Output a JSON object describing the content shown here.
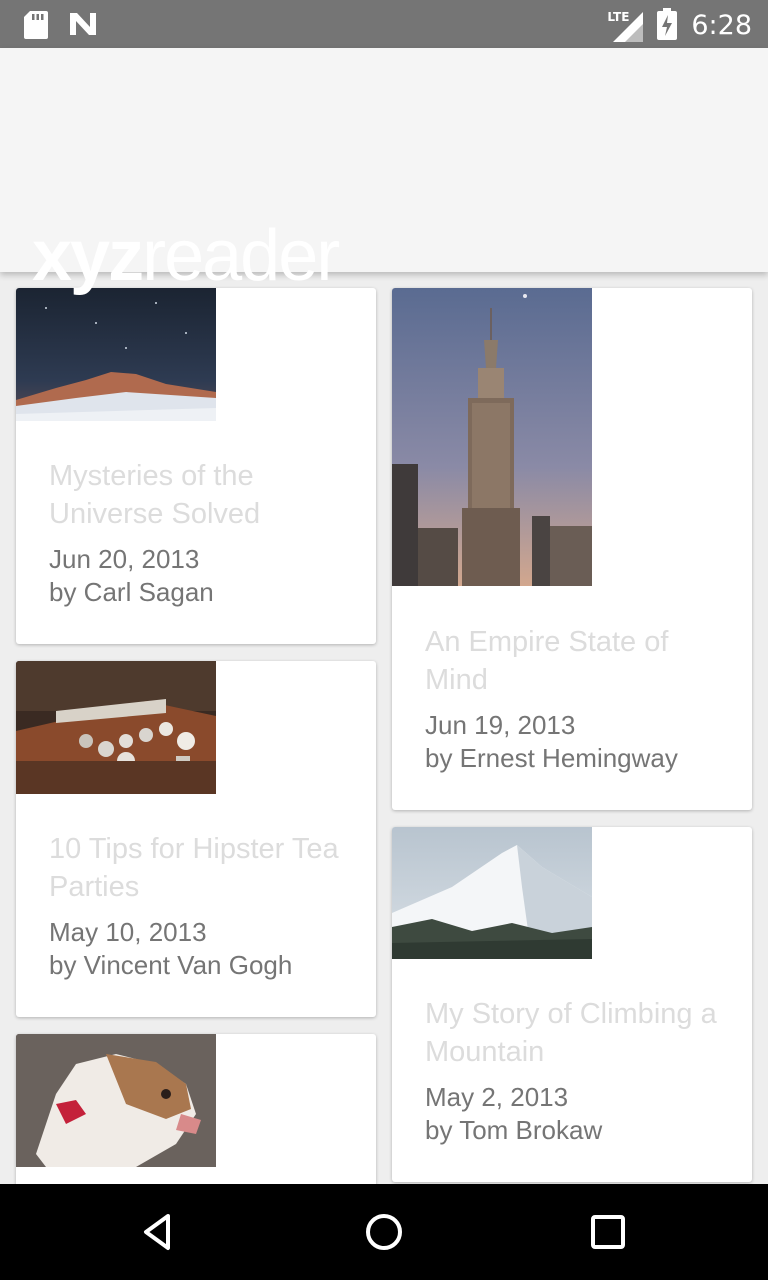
{
  "status_bar": {
    "time": "6:28",
    "network_label": "LTE",
    "icons": [
      "sd-card-icon",
      "n-notification-icon",
      "signal-icon",
      "battery-charging-icon"
    ]
  },
  "app_bar": {
    "logo_bold": "xyz",
    "logo_light": "reader"
  },
  "colors": {
    "status_bar_bg": "#757575",
    "app_bar_bg": "#f5f5f5",
    "card_title": "#dcdcdc",
    "card_meta": "#757575",
    "nav_bar_bg": "#000000"
  },
  "articles": [
    {
      "title": "Mysteries of the Universe Solved",
      "date": "Jun 20, 2013",
      "author": "by Carl Sagan",
      "image": "night-sky-mountain-photo"
    },
    {
      "title": "An Empire State of Mind",
      "date": "Jun 19, 2013",
      "author": "by Ernest Hemingway",
      "image": "empire-state-building-photo"
    },
    {
      "title": "10 Tips for Hipster Tea Parties",
      "date": "May 10, 2013",
      "author": "by Vincent Van Gogh",
      "image": "tea-cups-table-photo"
    },
    {
      "title": "My Story of Climbing a Mountain",
      "date": "May 2, 2013",
      "author": "by Tom Brokaw",
      "image": "snowy-mountain-photo"
    },
    {
      "title": "",
      "date": "",
      "author": "",
      "image": "bulldog-photo"
    }
  ],
  "nav_bar": {
    "buttons": [
      "back-icon",
      "home-icon",
      "recents-icon"
    ]
  }
}
